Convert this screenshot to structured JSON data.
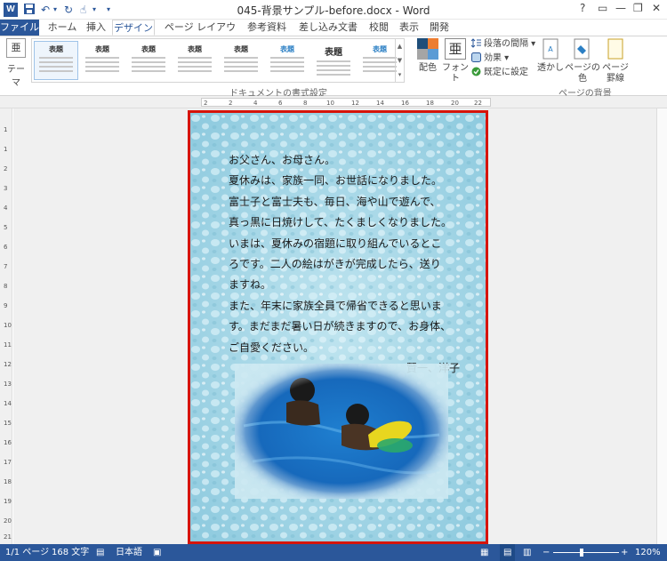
{
  "window": {
    "title": "045-背景サンプル-before.docx - Word",
    "app_icon": "W",
    "controls": [
      "?",
      "—",
      "❐",
      "✕"
    ]
  },
  "tabs": [
    {
      "label": "ファイル"
    },
    {
      "label": "ホーム"
    },
    {
      "label": "挿入"
    },
    {
      "label": "デザイン"
    },
    {
      "label": "ページ レイアウト"
    },
    {
      "label": "参考資料"
    },
    {
      "label": "差し込み文書"
    },
    {
      "label": "校閲"
    },
    {
      "label": "表示"
    },
    {
      "label": "開発"
    }
  ],
  "ribbon": {
    "theme_label": "テーマ",
    "theme_icon_text": "亜",
    "style_headings": [
      "表題",
      "表題",
      "表題",
      "表題",
      "表題",
      "表題",
      "表題",
      "表題"
    ],
    "group_document_format": "ドキュメントの書式設定",
    "colors_label": "配色",
    "fonts_label": "フォント",
    "fonts_icon_text": "亜",
    "paragraph_spacing": "段落の間隔",
    "effects": "効果",
    "set_default": "既定に設定",
    "watermark": "透かし",
    "page_color": "ページの色",
    "page_borders_1": "ページ",
    "page_borders_2": "罫線",
    "group_page_background": "ページの背景"
  },
  "ruler": {
    "h_labels": [
      "2",
      "2",
      "4",
      "6",
      "8",
      "10",
      "12",
      "14",
      "16",
      "18",
      "20",
      "22"
    ],
    "v_labels": [
      "1",
      "1",
      "2",
      "3",
      "4",
      "5",
      "6",
      "7",
      "8",
      "9",
      "10",
      "11",
      "12",
      "13",
      "14",
      "15",
      "16",
      "17",
      "18",
      "19",
      "20",
      "21"
    ]
  },
  "document": {
    "lines": [
      "お父さん、お母さん。",
      "夏休みは、家族一同、お世話になりました。",
      "富士子と富士夫も、毎日、海や山で遊んで、",
      "真っ黒に日焼けして、たくましくなりました。",
      "いまは、夏休みの宿題に取り組んでいるとこ",
      "ろです。二人の絵はがきが完成したら、送り",
      "ますね。",
      "また、年末に家族全員で帰省できると思いま",
      "す。まだまだ暑い日が続きますので、お身体、",
      "ご自愛ください。"
    ],
    "signature": "賢一、洋子"
  },
  "status": {
    "page": "1/1 ページ",
    "words": "168 文字",
    "language": "日本語",
    "zoom": "120%",
    "minus": "−",
    "plus": "+"
  },
  "colors": {
    "accent": "#2b579a",
    "page_border": "#d6140a",
    "water_bg": "#9fd4e6"
  }
}
